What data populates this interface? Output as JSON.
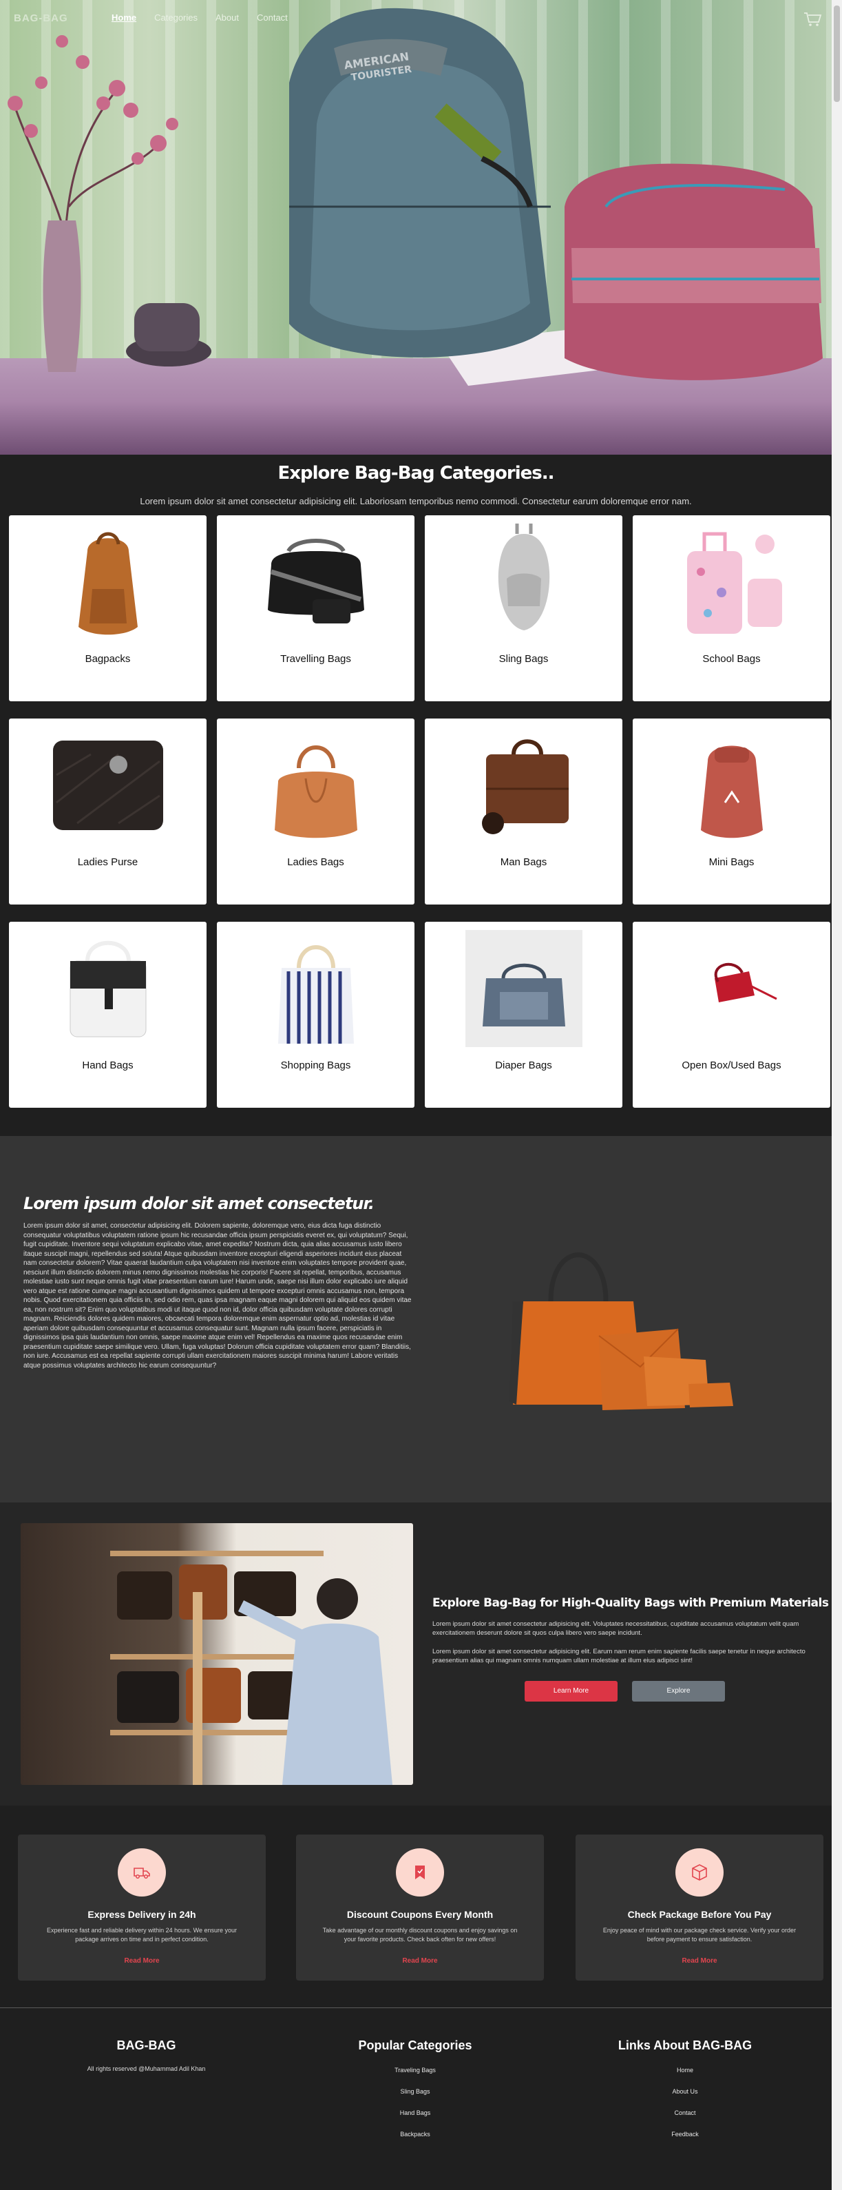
{
  "nav": {
    "logo": "BAG-BAG",
    "links": [
      "Home",
      "Categories",
      "About",
      "Contact"
    ],
    "cart_icon": "cart-icon"
  },
  "categories": {
    "title": "Explore Bag-Bag Categories..",
    "subtitle": "Lorem ipsum dolor sit amet consectetur adipisicing elit. Laboriosam temporibus nemo commodi. Consectetur earum doloremque error nam.",
    "items": [
      {
        "label": "Bagpacks"
      },
      {
        "label": "Travelling Bags"
      },
      {
        "label": "Sling Bags"
      },
      {
        "label": "School Bags"
      },
      {
        "label": "Ladies Purse"
      },
      {
        "label": "Ladies Bags"
      },
      {
        "label": "Man Bags"
      },
      {
        "label": "Mini Bags"
      },
      {
        "label": "Hand Bags"
      },
      {
        "label": "Shopping Bags"
      },
      {
        "label": "Diaper Bags"
      },
      {
        "label": "Open Box/Used Bags"
      }
    ]
  },
  "promo": {
    "heading": "Lorem ipsum dolor sit amet consectetur.",
    "body": "Lorem ipsum dolor sit amet, consectetur adipisicing elit. Dolorem sapiente, doloremque vero, eius dicta fuga distinctio consequatur voluptatibus voluptatem ratione ipsum hic recusandae officia ipsum perspiciatis everet ex, qui voluptatum? Sequi, fugit cupiditate. Inventore sequi voluptatum explicabo vitae, amet expedita? Nostrum dicta, quia alias accusamus iusto libero itaque suscipit magni, repellendus sed soluta! Atque quibusdam inventore excepturi eligendi asperiores incidunt eius placeat nam consectetur dolorem? Vitae quaerat laudantium culpa voluptatem nisi inventore enim voluptates tempore provident quae, nesciunt illum distinctio dolorem minus nemo dignissimos molestias hic corporis! Facere sit repellat, temporibus, accusamus molestiae iusto sunt neque omnis fugit vitae praesentium earum iure! Harum unde, saepe nisi illum dolor explicabo iure aliquid vero atque est ratione cumque magni accusantium dignissimos quidem ut tempore excepturi omnis accusamus non, tempora nobis. Quod exercitationem quia officiis in, sed odio rem, quas ipsa magnam eaque magni dolorem qui aliquid eos quidem vitae ea, non nostrum sit? Enim quo voluptatibus modi ut itaque quod non id, dolor officia quibusdam voluptate dolores corrupti magnam. Reiciendis dolores quidem maiores, obcaecati tempora doloremque enim aspernatur optio ad, molestias id vitae aperiam dolore quibusdam consequuntur et accusamus consequatur sunt. Magnam nulla ipsum facere, perspiciatis in dignissimos ipsa quis laudantium non omnis, saepe maxime atque enim vel! Repellendus ea maxime quos recusandae enim praesentium cupiditate saepe similique vero. Ullam, fuga voluptas! Dolorum officia cupiditate voluptatem error quam? Blanditiis, non iure. Accusamus est ea repellat sapiente corrupti ullam exercitationem maiores suscipit minima harum! Labore veritatis atque possimus voluptates architecto hic earum consequuntur?"
  },
  "premium": {
    "heading": "Explore Bag-Bag for High-Quality Bags with Premium Materials",
    "para1": "Lorem ipsum dolor sit amet consectetur adipisicing elit. Voluptates necessitatibus, cupiditate accusamus voluptatum velit quam exercitationem deserunt dolore sit quos culpa libero vero saepe incidunt.",
    "para2": "Lorem ipsum dolor sit amet consectetur adipisicing elit. Earum nam rerum enim sapiente facilis saepe tenetur in neque architecto praesentium alias qui magnam omnis numquam ullam molestiae at illum eius adipisci sint!",
    "learn_label": "Learn More",
    "explore_label": "Explore"
  },
  "features": [
    {
      "icon": "truck-icon",
      "title": "Express Delivery in 24h",
      "desc": "Experience fast and reliable delivery within 24 hours. We ensure your package arrives on time and in perfect condition.",
      "link": "Read More"
    },
    {
      "icon": "coupon-icon",
      "title": "Discount Coupons Every Month",
      "desc": "Take advantage of our monthly discount coupons and enjoy savings on your favorite products. Check back often for new offers!",
      "link": "Read More"
    },
    {
      "icon": "box-icon",
      "title": "Check Package Before You Pay",
      "desc": "Enjoy peace of mind with our package check service. Verify your order before payment to ensure satisfaction.",
      "link": "Read More"
    }
  ],
  "footer": {
    "brand": "BAG-BAG",
    "rights": "All rights reserved @Muhammad Adil Khan",
    "popular_heading": "Popular Categories",
    "popular": [
      "Traveling Bags",
      "Sling Bags",
      "Hand Bags",
      "Backpacks"
    ],
    "links_heading": "Links About BAG-BAG",
    "links": [
      "Home",
      "About Us",
      "Contact",
      "Feedback"
    ]
  },
  "colors": {
    "accent_red": "#dc3545",
    "secondary_gray": "#6c757d",
    "page_bg": "#1f1f1f",
    "icon_circle": "#fcd8cf"
  }
}
